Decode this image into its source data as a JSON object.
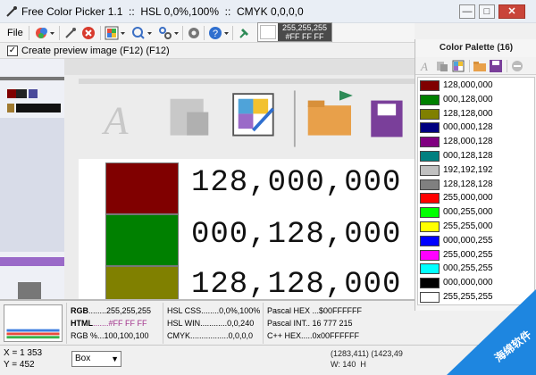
{
  "window": {
    "title": "Free Color Picker 1.1  ::  HSL 0,0%,100%  ::  CMYK 0,0,0,0",
    "minimize_glyph": "—",
    "maximize_glyph": "□",
    "close_glyph": "✕"
  },
  "toolbar": {
    "file_label": "File",
    "hex_line1": "255,255,255",
    "hex_line2": "#FF FF FF"
  },
  "preview_checkbox": {
    "label": "Create preview image (F12) (F12)",
    "checked": true,
    "mark": "✓"
  },
  "zoom_view": {
    "rows": [
      {
        "text": "128,000,000",
        "color": "#800000"
      },
      {
        "text": "000,128,000",
        "color": "#008000"
      },
      {
        "text": "128,128,000",
        "color": "#808000"
      }
    ]
  },
  "palette": {
    "title": "Color Palette (16)",
    "items": [
      {
        "label": "128,000,000",
        "color": "#800000"
      },
      {
        "label": "000,128,000",
        "color": "#008000"
      },
      {
        "label": "128,128,000",
        "color": "#808000"
      },
      {
        "label": "000,000,128",
        "color": "#000080"
      },
      {
        "label": "128,000,128",
        "color": "#800080"
      },
      {
        "label": "000,128,128",
        "color": "#008080"
      },
      {
        "label": "192,192,192",
        "color": "#c0c0c0"
      },
      {
        "label": "128,128,128",
        "color": "#808080"
      },
      {
        "label": "255,000,000",
        "color": "#ff0000"
      },
      {
        "label": "000,255,000",
        "color": "#00ff00"
      },
      {
        "label": "255,255,000",
        "color": "#ffff00"
      },
      {
        "label": "000,000,255",
        "color": "#0000ff"
      },
      {
        "label": "255,000,255",
        "color": "#ff00ff"
      },
      {
        "label": "000,255,255",
        "color": "#00ffff"
      },
      {
        "label": "000,000,000",
        "color": "#000000"
      },
      {
        "label": "255,255,255",
        "color": "#ffffff"
      }
    ]
  },
  "info": {
    "rgb_key": "RGB",
    "rgb_val": "........255,255,255",
    "html_key": "HTML",
    "html_val": ".......#FF FF FF",
    "rgbp_key": "RGB %",
    "rgbp_val": "...100,100,100",
    "hslcss": "HSL CSS........0,0%,100%",
    "hslwin": "HSL WIN............0,0,240",
    "cmyk": "CMYK.................0,0,0,0",
    "pascal_hex": "Pascal HEX ...$00FFFFFF",
    "pascal_int": "Pascal INT.. 16 777 215",
    "cpp_hex": "C++ HEX.....0x00FFFFFF"
  },
  "status": {
    "x": "X = 1 353",
    "y": "Y = 452",
    "mode": "Box",
    "right_line1": "(1283,411) (1423,49",
    "right_line2": "W: 140  H"
  },
  "watermark": {
    "text": "海绵软件"
  }
}
